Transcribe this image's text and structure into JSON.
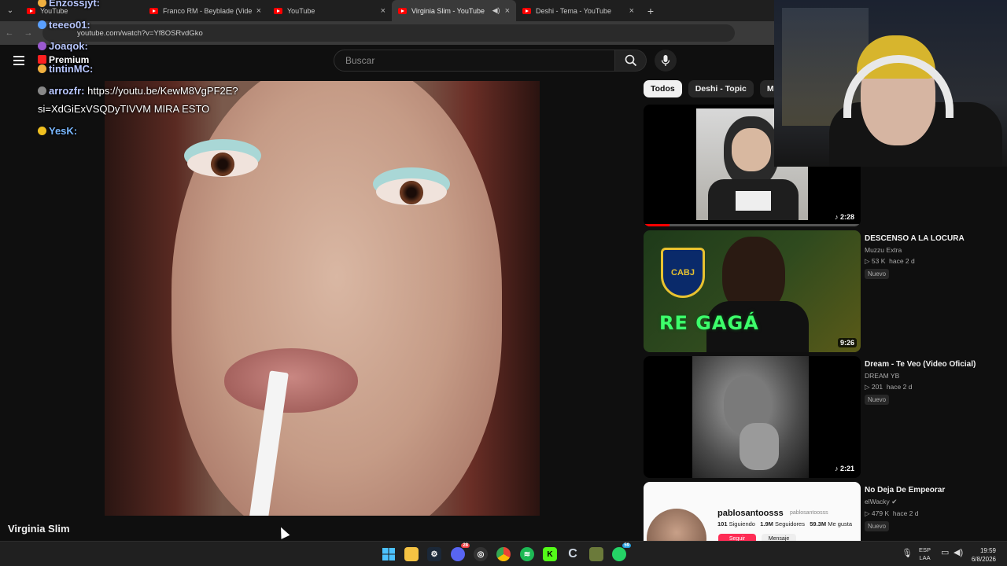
{
  "browser": {
    "tabs": [
      {
        "title": "YouTube",
        "active": false
      },
      {
        "title": "Franco RM - Beyblade (Video O",
        "active": false
      },
      {
        "title": "YouTube",
        "active": false
      },
      {
        "title": "Virginia Slim - YouTube",
        "active": true
      },
      {
        "title": "Deshi - Tema - YouTube",
        "active": false
      }
    ],
    "new_tab_symbol": "+",
    "close_symbol": "×",
    "url": "youtube.com/watch?v=Yf8OSRvdGko"
  },
  "youtube": {
    "search_placeholder": "Buscar",
    "video_title": "Virginia Slim",
    "chips": [
      "Todos",
      "Deshi - Topic",
      "Música"
    ]
  },
  "chat": [
    {
      "user": "Enzossjyt:",
      "message": ""
    },
    {
      "user": "teeeo01:",
      "message": ""
    },
    {
      "user": "Joaqok:",
      "message": ""
    },
    {
      "user": "tintinMC:",
      "message": ""
    },
    {
      "user": "arrozfr:",
      "message": "https://youtu.be/KewM8VgPF2E?"
    },
    {
      "user": "",
      "message": "si=XdGiExVSQDyTIVVM MIRA ESTO"
    },
    {
      "user": "YesK:",
      "message": ""
    }
  ],
  "chat_badge_text": "Premium",
  "recommendations": [
    {
      "title": "",
      "channel": "",
      "views": "",
      "age": "",
      "badge": "",
      "duration": "2:28"
    },
    {
      "title": "DESCENSO A LA LOCURA",
      "channel": "Muzzu Extra",
      "views": "53 K",
      "age": "hace 2 d",
      "badge": "Nuevo",
      "duration": "9:26",
      "overlay": "RE GAGÁ",
      "crest": "CABJ"
    },
    {
      "title": "Dream - Te Veo (Video Oficial)",
      "channel": "DREAM YB",
      "views": "201",
      "age": "hace 2 d",
      "badge": "Nuevo",
      "duration": "2:21"
    },
    {
      "title": "No Deja De Empeorar",
      "channel": "elWacky",
      "views": "479 K",
      "age": "hace 2 d",
      "badge": "Nuevo",
      "duration": ""
    }
  ],
  "profile_card": {
    "name": "pablosantoosss",
    "handle": "pablosantoosss",
    "following": "101",
    "following_label": "Siguiendo",
    "followers": "1.9M",
    "followers_label": "Seguidores",
    "likes": "59.3M",
    "likes_label": "Me gusta",
    "follow_button": "Seguir",
    "message_button": "Mensaje"
  },
  "taskbar": {
    "lang_top": "ESP",
    "lang_bottom": "LAA",
    "time": "19:59",
    "date": "6/8/2026",
    "discord_badge": "28",
    "whatsapp_badge": "59"
  },
  "colors": {
    "yt_red": "#ff0000",
    "chat_user": "#b8c7ff",
    "green_text": "#3dff6b"
  }
}
